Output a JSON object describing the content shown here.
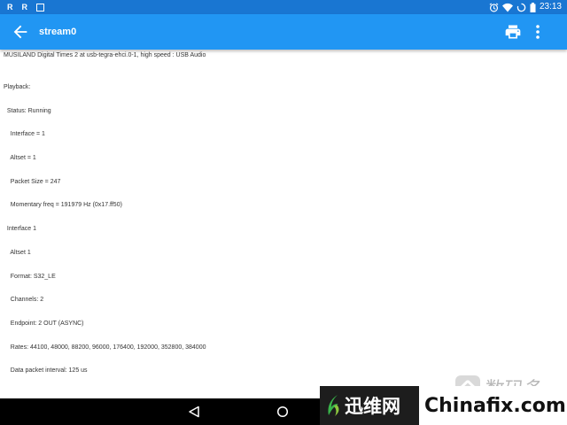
{
  "status_bar": {
    "left_icons": [
      "R",
      "R"
    ],
    "time": "23:13",
    "icons": [
      "alarm-icon",
      "wifi-icon",
      "sync-icon",
      "battery-icon"
    ]
  },
  "app_bar": {
    "title": "stream0",
    "back_icon": "arrow-back-icon",
    "actions": [
      "print-icon",
      "more-vert-icon"
    ]
  },
  "content": {
    "header": "MUSILAND Digital Times 2 at usb-tegra-ehci.0-1, high speed : USB Audio",
    "lines": [
      "Playback:",
      "  Status: Running",
      "    Interface = 1",
      "    Altset = 1",
      "    Packet Size = 247",
      "    Momentary freq = 191979 Hz (0x17.ff50)",
      "  Interface 1",
      "    Altset 1",
      "    Format: S32_LE",
      "    Channels: 2",
      "    Endpoint: 2 OUT (ASYNC)",
      "    Rates: 44100, 48000, 88200, 96000, 176400, 192000, 352800, 384000",
      "    Data packet interval: 125 us"
    ]
  },
  "nav_bar": {
    "buttons": [
      "nav-back-icon",
      "nav-home-icon",
      "nav-recents-icon"
    ]
  },
  "watermarks": {
    "brand1": "数码多",
    "brand2_cn": "迅维网",
    "brand2_site": "Chinafix.com"
  }
}
